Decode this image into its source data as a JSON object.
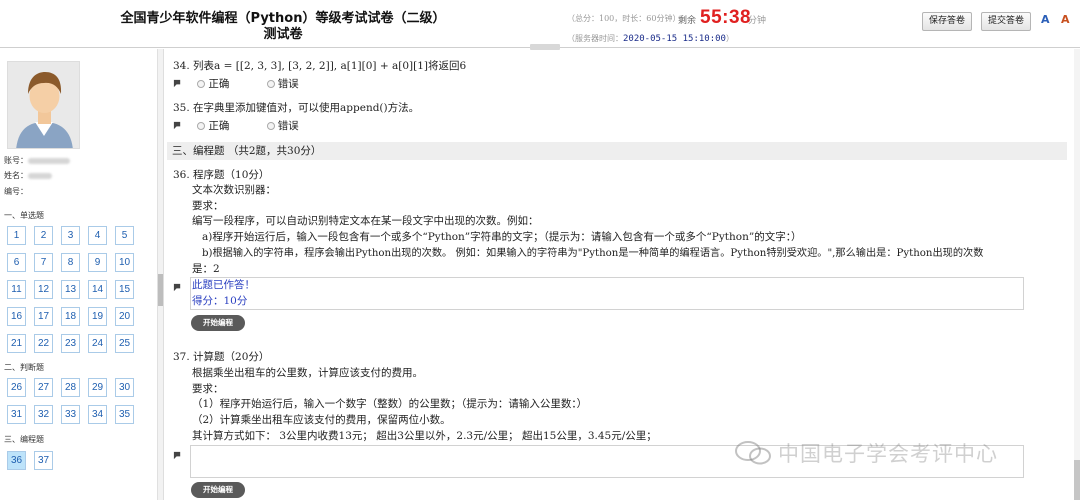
{
  "header": {
    "title_line1": "全国青少年软件编程（Python）等级考试试卷（二级）",
    "title_line2": "测试卷",
    "meta": "（总分：100，时长：60分钟）",
    "remain_label": "剩余",
    "timer": "55:38",
    "timer_unit": "分钟",
    "server_label": "（服务器时间：",
    "server_time": "2020-05-15 15:10:00",
    "server_close": "）",
    "save_label": "保存答卷",
    "submit_label": "提交答卷",
    "font_icon_a": "A",
    "font_icon_b": "A"
  },
  "sidebar": {
    "account_label": "账号：",
    "name_label": "姓名：",
    "id_label": "编号：",
    "sections": [
      {
        "label": "一、单选题",
        "items": [
          "1",
          "2",
          "3",
          "4",
          "5",
          "6",
          "7",
          "8",
          "9",
          "10",
          "11",
          "12",
          "13",
          "14",
          "15",
          "16",
          "17",
          "18",
          "19",
          "20",
          "21",
          "22",
          "23",
          "24",
          "25"
        ]
      },
      {
        "label": "二、判断题",
        "items": [
          "26",
          "27",
          "28",
          "29",
          "30",
          "31",
          "32",
          "33",
          "34",
          "35"
        ]
      },
      {
        "label": "三、编程题",
        "items": [
          "36",
          "37"
        ]
      }
    ]
  },
  "questions": {
    "q34": {
      "text": "34. 列表a = [[2, 3, 3], [3, 2, 2]], a[1][0] + a[0][1]将返回6",
      "opt_true": "正确",
      "opt_false": "错误"
    },
    "q35": {
      "text": "35. 在字典里添加键值对，可以使用append()方法。",
      "opt_true": "正确",
      "opt_false": "错误"
    },
    "section3": "三、编程题 （共2题，共30分）",
    "q36": {
      "title": "36. 程序题（10分）",
      "lines": [
        "文本次数识别器：",
        "要求：",
        "编写一段程序，可以自动识别特定文本在某一段文字中出现的次数。例如：",
        "a)程序开始运行后，输入一段包含有一个或多个“Python”字符串的文字；（提示为：请输入包含有一个或多个“Python”的文字：）",
        "b)根据输入的字符串，程序会输出Python出现的次数。  例如：如果输入的字符串为\"Python是一种简单的编程语言。Python特别受欢迎。\",那么输出是：Python出现的次数",
        "是：2"
      ],
      "answered": "此题已作答！",
      "score": "得分：10分",
      "start_btn": "开始编程"
    },
    "q37": {
      "title": "37. 计算题（20分）",
      "lines": [
        "根据乘坐出租车的公里数，计算应该支付的费用。",
        "要求：",
        "（1）程序开始运行后，输入一个数字（整数）的公里数；（提示为：请输入公里数：）",
        "（2）计算乘坐出租车应该支付的费用，保留两位小数。",
        "其计算方式如下：  3公里内收费13元；  超出3公里以外，2.3元/公里；  超出15公里，3.45元/公里；"
      ],
      "start_btn": "开始编程"
    }
  },
  "watermark": "中国电子学会考评中心"
}
